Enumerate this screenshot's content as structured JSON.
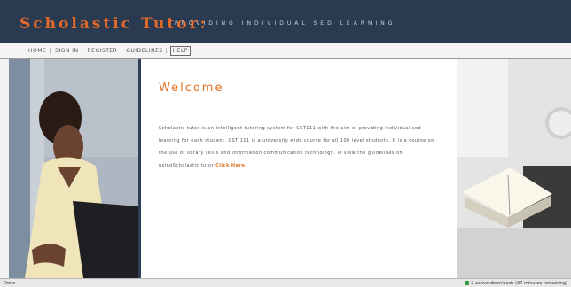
{
  "header": {
    "title": "Scholastic Tutor:",
    "tagline": "PROVIDING INDIVIDUALISED LEARNING"
  },
  "nav": {
    "items": [
      {
        "label": "HOME"
      },
      {
        "label": "SIGN IN"
      },
      {
        "label": "REGISTER"
      },
      {
        "label": "GUIDELINES"
      },
      {
        "label": "HELP"
      }
    ],
    "active_index": 4
  },
  "main": {
    "heading": "Welcome",
    "paragraph": "Scholastic tutor is an intelligent tutoring system for CST111 with the aim of providing individualised learning for each student. CST 111 is a university wide course for all 100 level students. It is a course on the use of library skills and information communication technology. To view the guidelines on usingScholastic tutor",
    "link_text": "Click Here."
  },
  "status_bar": {
    "left": "Done",
    "right": "2 active downloads (37 minutes remaining)"
  },
  "colors": {
    "header_bg": "#2a3a50",
    "accent": "#e06a2a",
    "border_dark": "#2f3f57"
  },
  "icons": {
    "status_right": "download-icon"
  }
}
